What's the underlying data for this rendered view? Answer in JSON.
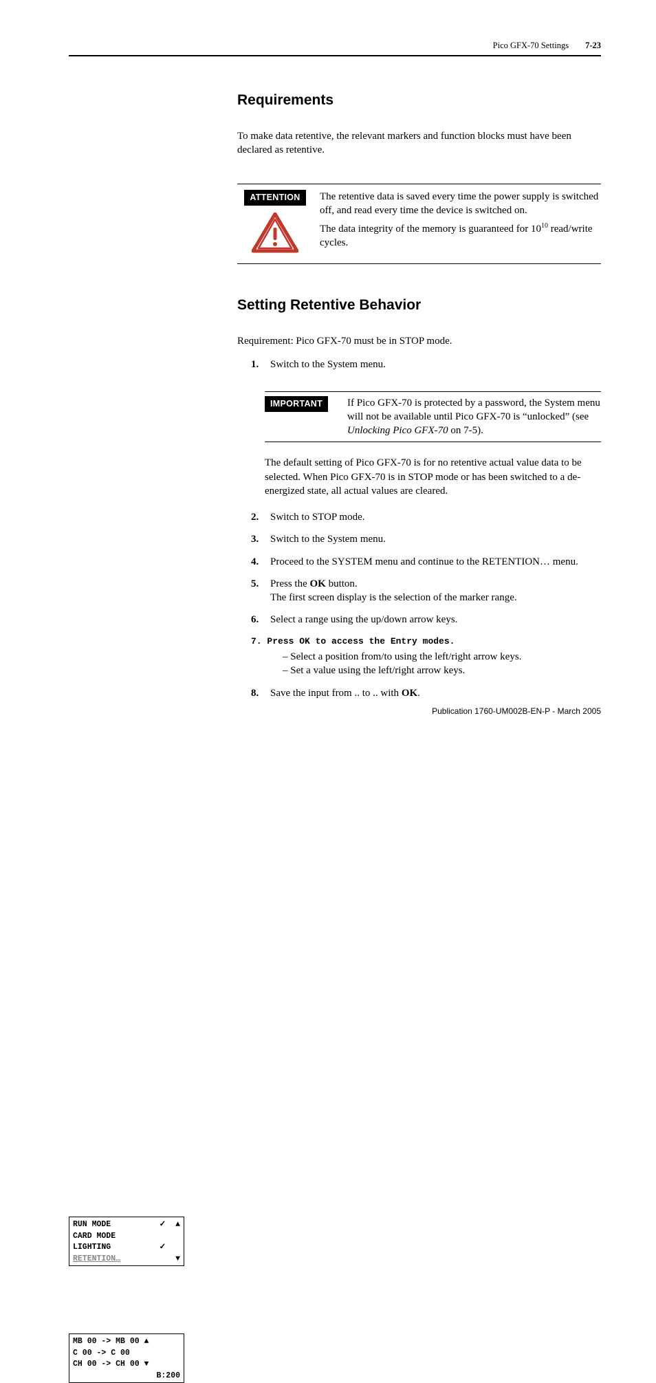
{
  "header": {
    "title": "Pico GFX-70 Settings",
    "pagenum": "7-23"
  },
  "sec1": {
    "heading": "Requirements",
    "p1": "To make data retentive, the relevant markers and function blocks must have been declared as retentive."
  },
  "attention": {
    "label": "ATTENTION",
    "p1": "The retentive data is saved every time the power supply is switched off, and read every time the device is switched on.",
    "p2a": "The data integrity of the memory is guaranteed for 10",
    "p2sup": "10",
    "p2b": " read/write cycles."
  },
  "sec2": {
    "heading": "Setting Retentive Behavior",
    "req": "Requirement: Pico GFX-70 must be in STOP mode.",
    "step1": "Switch to the System menu."
  },
  "important": {
    "label": "IMPORTANT",
    "text_a": "If Pico GFX-70 is protected by a password, the System menu will not be available until Pico GFX-70 is “unlocked” (see ",
    "text_em": "Unlocking Pico GFX-70",
    "text_b": " on 7-5)."
  },
  "para_default": "The default setting of Pico GFX-70 is for no retentive actual value data to be selected. When Pico GFX-70 is in STOP mode or has been switched to a de-energized state, all actual values are cleared.",
  "steps": {
    "s2": "Switch to STOP mode.",
    "s3": "Switch to the System menu.",
    "s4": "Proceed to the SYSTEM menu and continue to the RETENTION… menu.",
    "s5a": "Press the ",
    "s5b": " button.",
    "s5c": "The first screen display is the selection of the marker range.",
    "s6": "Select a range using the up/down arrow keys.",
    "s7": "7. Press OK to access the Entry modes.",
    "s7a": "Select a position from/to using the left/right arrow keys.",
    "s7b": "Set a value using the left/right arrow keys.",
    "s8a": "Save the input from .. to .. with ",
    "s8b": "."
  },
  "ok": "OK",
  "lcd1": {
    "r1a": "RUN MODE",
    "r1b": "✓  ▲",
    "r2": "CARD MODE",
    "r3a": "LIGHTING",
    "r3b": "✓   ",
    "r4a": "RETENTION…",
    "r4b": "▼"
  },
  "lcd2": {
    "r1": "MB 00 -> MB 00 ▲",
    "r2": "C  00 -> C  00",
    "r3": "CH 00 -> CH 00 ▼",
    "r4": "B:200"
  },
  "footer": "Publication 1760-UM002B-EN-P - March 2005"
}
